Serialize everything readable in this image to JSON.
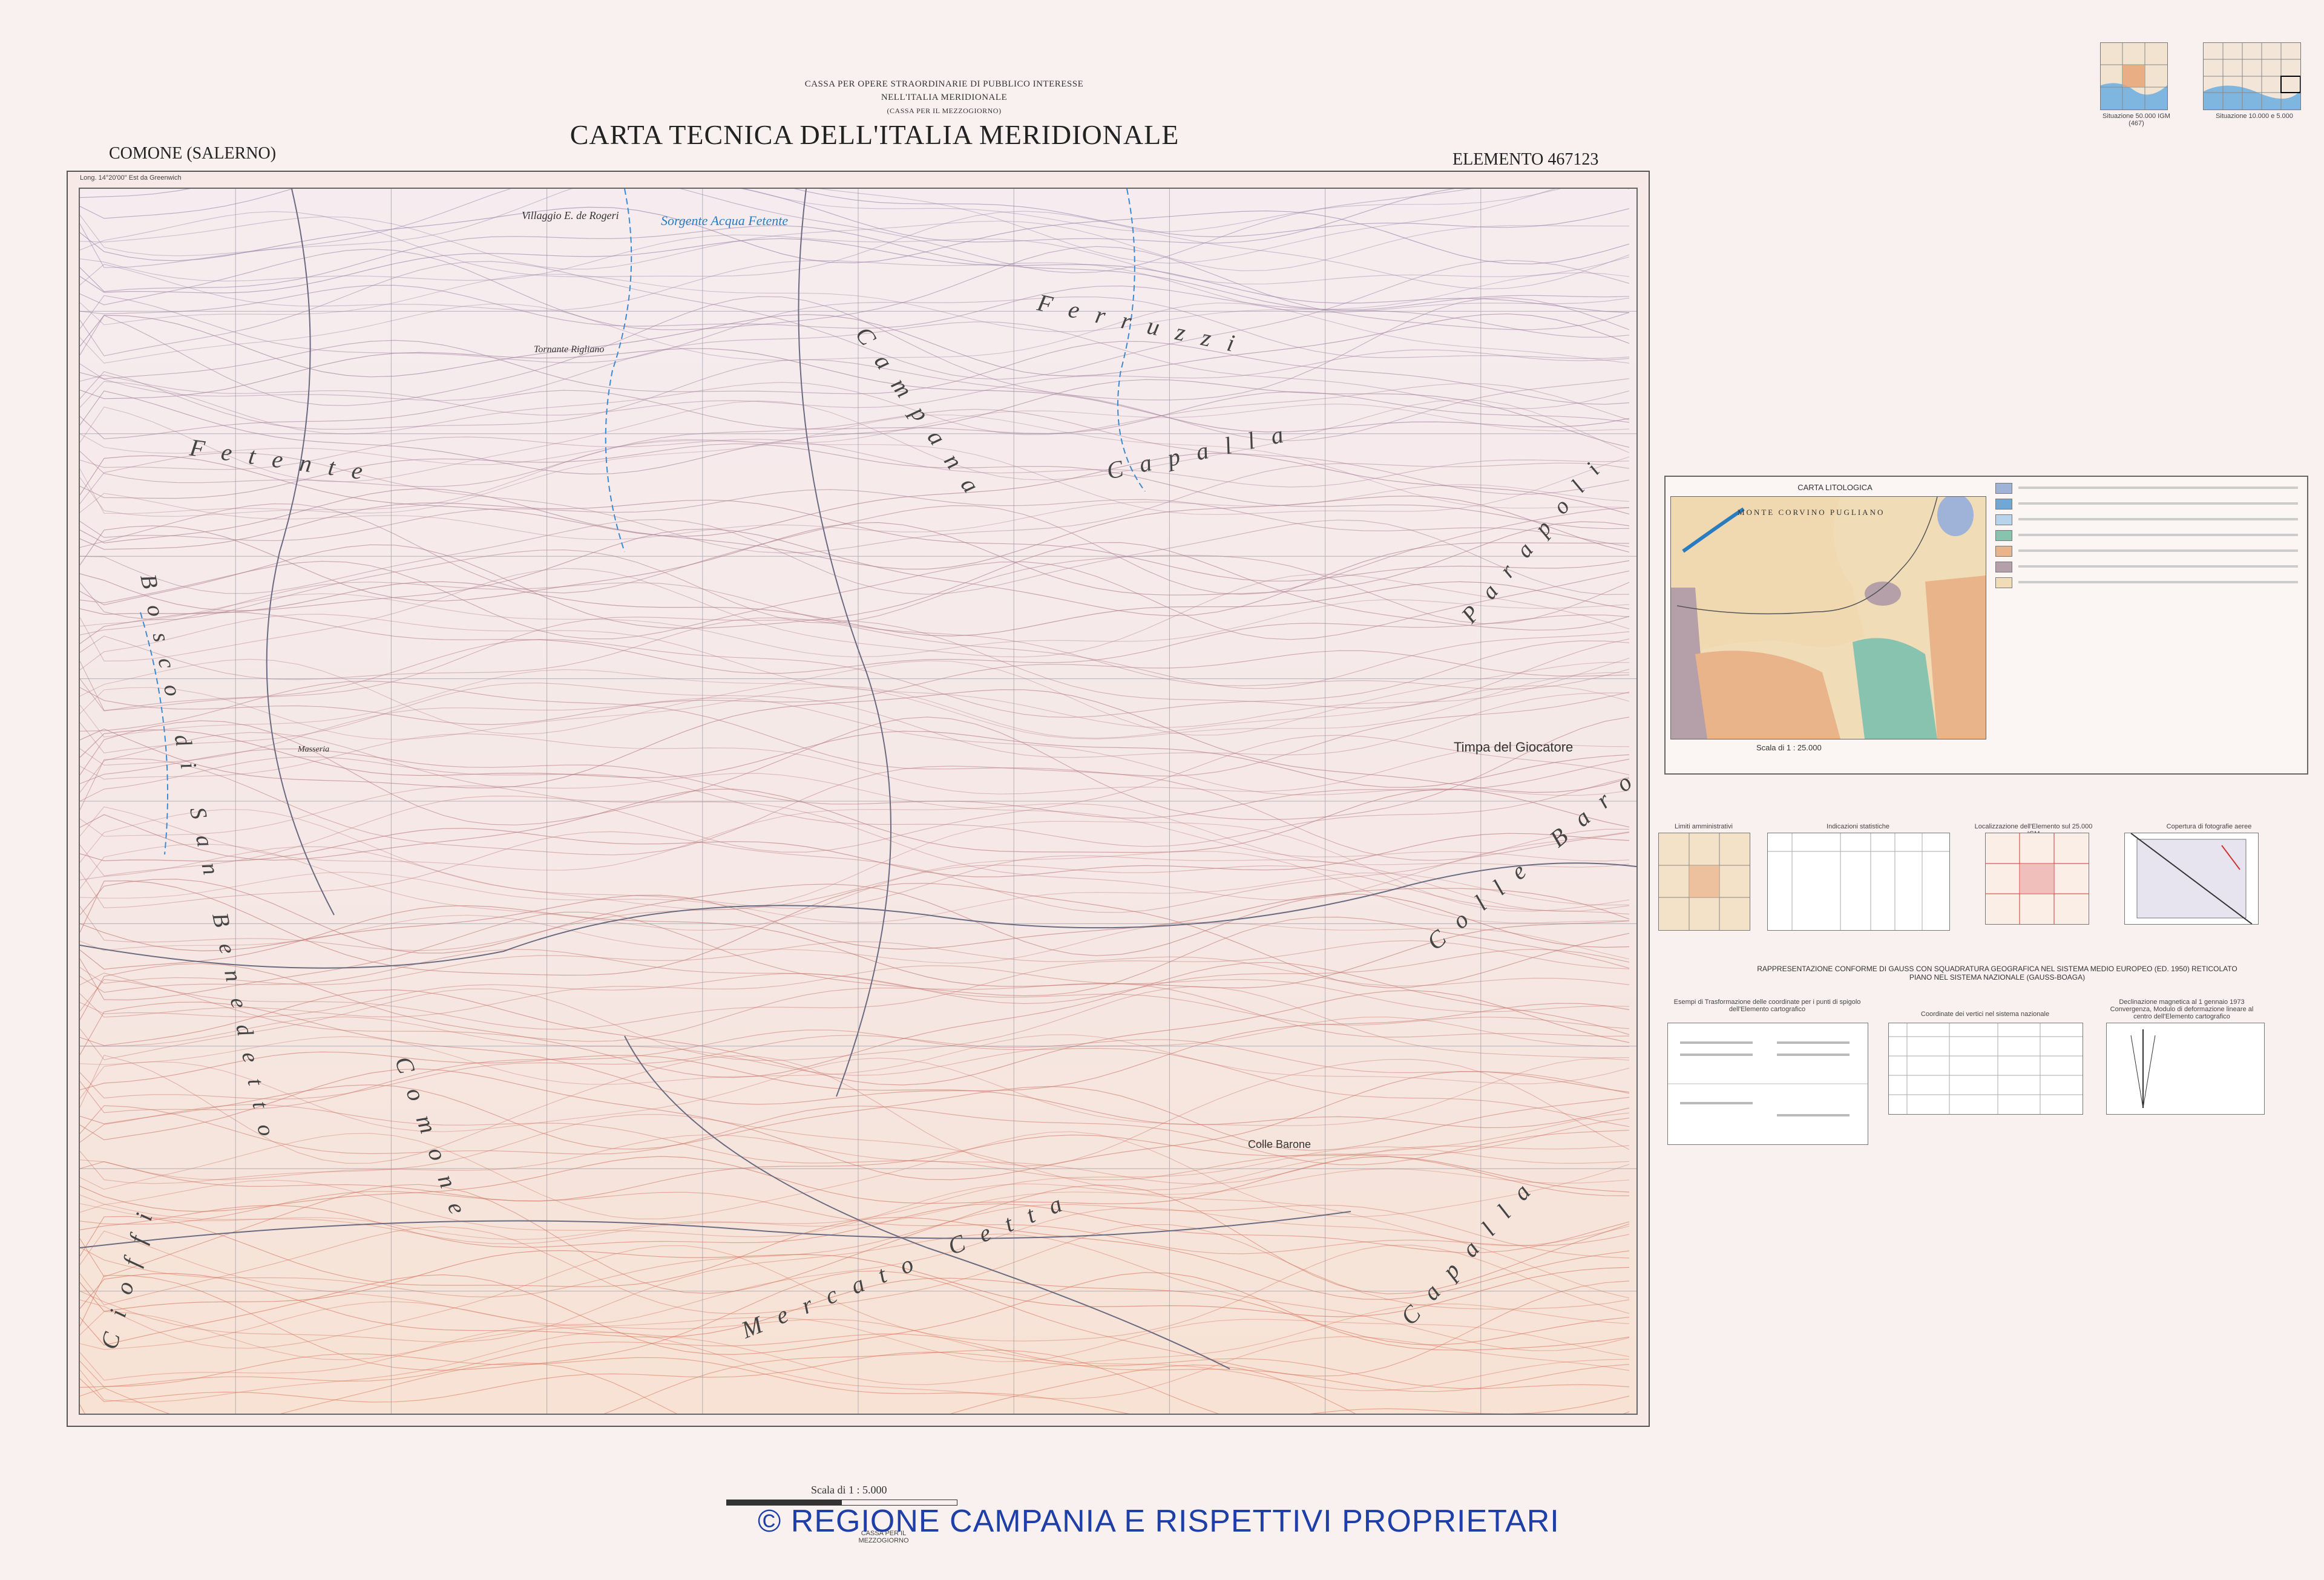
{
  "header": {
    "line1": "CASSA PER OPERE STRAORDINARIE DI PUBBLICO INTERESSE",
    "line2": "NELL'ITALIA MERIDIONALE",
    "line3": "(CASSA PER IL MEZZOGIORNO)",
    "title": "CARTA TECNICA DELL'ITALIA MERIDIONALE",
    "municipality": "COMONE (SALERNO)",
    "element": "ELEMENTO 467123"
  },
  "map": {
    "long_label": "Long. 14°20'00\" Est da Greenwich",
    "places": {
      "fetente": "Fetente",
      "bosco": "Bosco di San Benedetto",
      "ferruzzi": "Ferruzzi",
      "campana": "Campana",
      "capalla": "Capalla",
      "parapoli": "Parapoli",
      "colle_barone": "Colle Barone",
      "cioffi": "Cioffi",
      "mercato": "Mercato Cetta",
      "como": "Comone",
      "timpa": "Timpa del Giocatore",
      "colle_barone_small": "Colle Barone",
      "sorgente": "Sorgente Acqua Fetente",
      "villaggio": "Villaggio E. de Rogeri",
      "tornante": "Tornante Rigliano",
      "masseria": "Masseria"
    }
  },
  "lithology": {
    "title": "CARTA LITOLOGICA",
    "map_label": "MONTE CORVINO PUGLIANO",
    "scale": "Scala di 1 : 25.000",
    "legend_colors": [
      "#9fb3d8",
      "#6fa7d6",
      "#b8d3ec",
      "#88c3b0",
      "#e9b48a",
      "#b59fa8",
      "#f1dcb8"
    ]
  },
  "panels": {
    "limiti": "Limiti amministrativi",
    "indicazioni": "Indicazioni statistiche",
    "localizzazione": "Localizzazione dell'Elemento sul 25.000 IGM",
    "copertura": "Copertura di fotografie aeree",
    "rappresentazione": "RAPPRESENTAZIONE CONFORME DI GAUSS CON SQUADRATURA GEOGRAFICA NEL SISTEMA MEDIO EUROPEO (ED. 1950) RETICOLATO PIANO NEL SISTEMA NAZIONALE (GAUSS-BOAGA)",
    "esempi": "Esempi di Trasformazione delle coordinate per i punti di spigolo dell'Elemento cartografico",
    "coordinate": "Coordinate dei vertici nel sistema nazionale",
    "declinazione": "Declinazione magnetica al 1 gennaio 1973 Convergenza, Modulo di deformazione lineare al centro dell'Elemento cartografico"
  },
  "scale_bar": {
    "label": "Scala di 1 : 5.000",
    "stamp": "CASSA PER IL MEZZOGIORNO"
  },
  "copyright": "© REGIONE CAMPANIA E RISPETTIVI PROPRIETARI",
  "index": {
    "situazione1": "Situazione 50.000 IGM (467)",
    "situazione2": "Situazione 10.000 e 5.000"
  }
}
